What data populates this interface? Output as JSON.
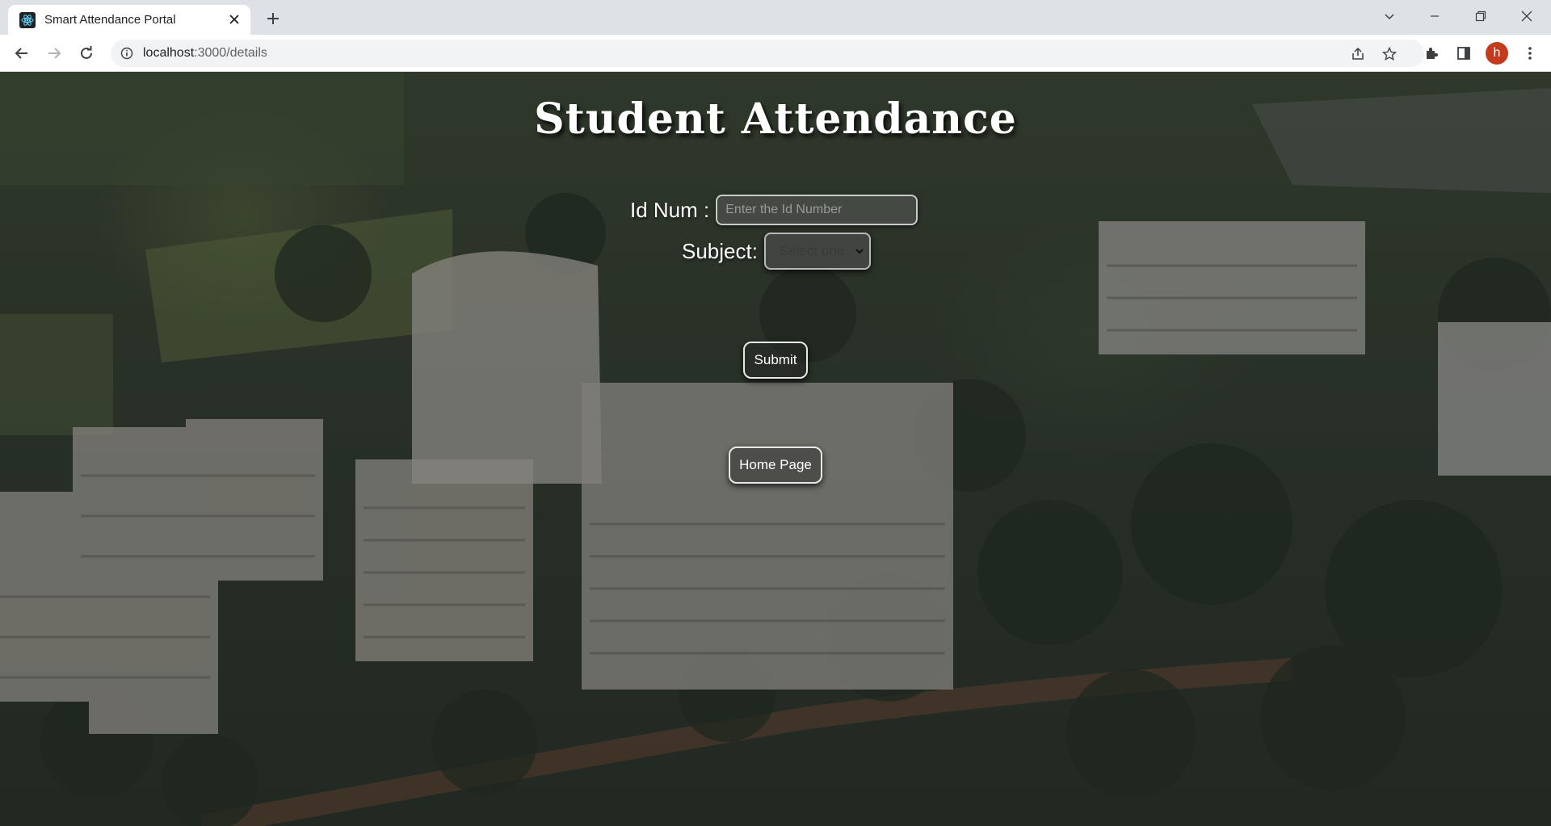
{
  "browser": {
    "tab_title": "Smart Attendance Portal",
    "url_host": "localhost",
    "url_path": ":3000/details",
    "avatar_letter": "h"
  },
  "page": {
    "title": "Student Attendance",
    "id_label": "Id Num :",
    "id_placeholder": "Enter the Id Number",
    "id_value": "",
    "subject_label": "Subject:",
    "subject_selected": "Select one",
    "submit_label": "Submit",
    "home_label": "Home Page"
  },
  "colors": {
    "avatar": "#c5391c",
    "button_border": "#e8e8e8"
  }
}
